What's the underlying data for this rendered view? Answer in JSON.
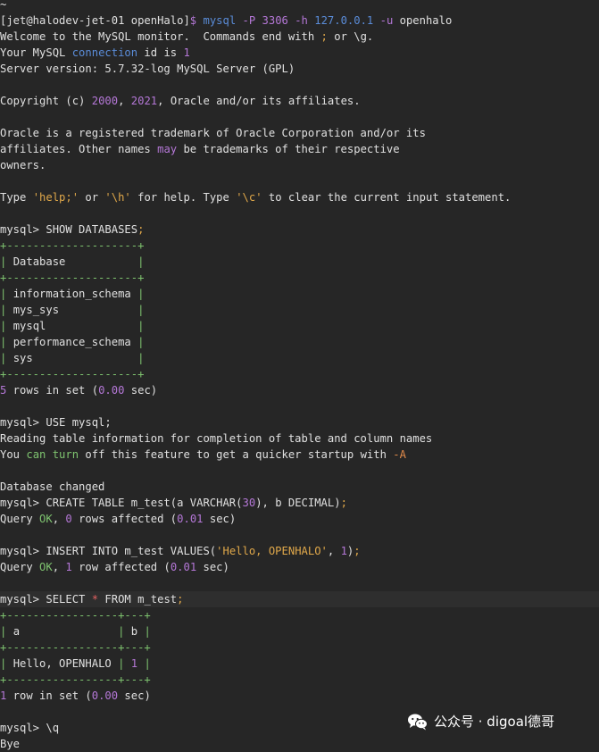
{
  "terminal": {
    "lines": [
      {
        "segs": [
          {
            "t": "~",
            "c": "w"
          }
        ]
      },
      {
        "segs": [
          {
            "t": "[jet@halodev-jet-01 openHalo]",
            "c": "w"
          },
          {
            "t": "$ ",
            "c": "p"
          },
          {
            "t": "mysql ",
            "c": "b"
          },
          {
            "t": "-P ",
            "c": "p"
          },
          {
            "t": "3306 ",
            "c": "p"
          },
          {
            "t": "-h ",
            "c": "p"
          },
          {
            "t": "127.0.0.1 ",
            "c": "b"
          },
          {
            "t": "-u ",
            "c": "p"
          },
          {
            "t": "openhalo",
            "c": "w"
          }
        ]
      },
      {
        "segs": [
          {
            "t": "Welcome to the MySQL monitor.  Commands end with ",
            "c": "w"
          },
          {
            "t": ";",
            "c": "y"
          },
          {
            "t": " or \\g.",
            "c": "w"
          }
        ]
      },
      {
        "segs": [
          {
            "t": "Your MySQL ",
            "c": "w"
          },
          {
            "t": "connection",
            "c": "b"
          },
          {
            "t": " id is ",
            "c": "w"
          },
          {
            "t": "1",
            "c": "p"
          }
        ]
      },
      {
        "segs": [
          {
            "t": "Server version: 5.7.32-log MySQL Server (GPL)",
            "c": "w"
          }
        ]
      },
      {
        "segs": []
      },
      {
        "segs": [
          {
            "t": "Copyright (c) ",
            "c": "w"
          },
          {
            "t": "2000",
            "c": "p"
          },
          {
            "t": ", ",
            "c": "w"
          },
          {
            "t": "2021",
            "c": "p"
          },
          {
            "t": ", Oracle and/or its affiliates.",
            "c": "w"
          }
        ]
      },
      {
        "segs": []
      },
      {
        "segs": [
          {
            "t": "Oracle is a registered trademark of Oracle Corporation and/or its",
            "c": "w"
          }
        ]
      },
      {
        "segs": [
          {
            "t": "affiliates. Other names ",
            "c": "w"
          },
          {
            "t": "may",
            "c": "p"
          },
          {
            "t": " be trademarks of their respective",
            "c": "w"
          }
        ]
      },
      {
        "segs": [
          {
            "t": "owners.",
            "c": "w"
          }
        ]
      },
      {
        "segs": []
      },
      {
        "segs": [
          {
            "t": "Type ",
            "c": "w"
          },
          {
            "t": "'help;'",
            "c": "y"
          },
          {
            "t": " or ",
            "c": "w"
          },
          {
            "t": "'\\h'",
            "c": "y"
          },
          {
            "t": " for help. Type ",
            "c": "w"
          },
          {
            "t": "'\\c'",
            "c": "y"
          },
          {
            "t": " to clear the current input statement.",
            "c": "w"
          }
        ]
      },
      {
        "segs": []
      },
      {
        "segs": [
          {
            "t": "mysql> SHOW DATABASES",
            "c": "w"
          },
          {
            "t": ";",
            "c": "y"
          }
        ]
      },
      {
        "segs": [
          {
            "t": "+--------------------+",
            "c": "g"
          }
        ]
      },
      {
        "segs": [
          {
            "t": "| ",
            "c": "g"
          },
          {
            "t": "Database           ",
            "c": "w"
          },
          {
            "t": "|",
            "c": "g"
          }
        ]
      },
      {
        "segs": [
          {
            "t": "+--------------------+",
            "c": "g"
          }
        ]
      },
      {
        "segs": [
          {
            "t": "| ",
            "c": "g"
          },
          {
            "t": "information_schema ",
            "c": "w"
          },
          {
            "t": "|",
            "c": "g"
          }
        ]
      },
      {
        "segs": [
          {
            "t": "| ",
            "c": "g"
          },
          {
            "t": "mys_sys            ",
            "c": "w"
          },
          {
            "t": "|",
            "c": "g"
          }
        ]
      },
      {
        "segs": [
          {
            "t": "| ",
            "c": "g"
          },
          {
            "t": "mysql              ",
            "c": "w"
          },
          {
            "t": "|",
            "c": "g"
          }
        ]
      },
      {
        "segs": [
          {
            "t": "| ",
            "c": "g"
          },
          {
            "t": "performance_schema ",
            "c": "w"
          },
          {
            "t": "|",
            "c": "g"
          }
        ]
      },
      {
        "segs": [
          {
            "t": "| ",
            "c": "g"
          },
          {
            "t": "sys                ",
            "c": "w"
          },
          {
            "t": "|",
            "c": "g"
          }
        ]
      },
      {
        "segs": [
          {
            "t": "+--------------------+",
            "c": "g"
          }
        ]
      },
      {
        "segs": [
          {
            "t": "5",
            "c": "p"
          },
          {
            "t": " rows in set (",
            "c": "w"
          },
          {
            "t": "0.00",
            "c": "p"
          },
          {
            "t": " sec)",
            "c": "w"
          }
        ]
      },
      {
        "segs": []
      },
      {
        "segs": [
          {
            "t": "mysql> USE mysql;",
            "c": "w"
          }
        ]
      },
      {
        "segs": [
          {
            "t": "Reading table information for completion of table and column names",
            "c": "w"
          }
        ]
      },
      {
        "segs": [
          {
            "t": "You ",
            "c": "w"
          },
          {
            "t": "can turn",
            "c": "g"
          },
          {
            "t": " off this feature to get a quicker startup with ",
            "c": "w"
          },
          {
            "t": "-A",
            "c": "o"
          }
        ]
      },
      {
        "segs": []
      },
      {
        "segs": [
          {
            "t": "Database changed",
            "c": "w"
          }
        ]
      },
      {
        "segs": [
          {
            "t": "mysql> CREATE TABLE m_test(a VARCHAR(",
            "c": "w"
          },
          {
            "t": "30",
            "c": "p"
          },
          {
            "t": "), b DECIMAL)",
            "c": "w"
          },
          {
            "t": ";",
            "c": "y"
          }
        ]
      },
      {
        "segs": [
          {
            "t": "Query ",
            "c": "w"
          },
          {
            "t": "OK",
            "c": "g"
          },
          {
            "t": ", ",
            "c": "w"
          },
          {
            "t": "0",
            "c": "p"
          },
          {
            "t": " rows affected (",
            "c": "w"
          },
          {
            "t": "0.01",
            "c": "p"
          },
          {
            "t": " sec)",
            "c": "w"
          }
        ]
      },
      {
        "segs": []
      },
      {
        "segs": [
          {
            "t": "mysql> INSERT INTO m_test VALUES(",
            "c": "w"
          },
          {
            "t": "'Hello, OPENHALO'",
            "c": "y"
          },
          {
            "t": ", ",
            "c": "w"
          },
          {
            "t": "1",
            "c": "p"
          },
          {
            "t": ")",
            "c": "w"
          },
          {
            "t": ";",
            "c": "y"
          }
        ]
      },
      {
        "segs": [
          {
            "t": "Query ",
            "c": "w"
          },
          {
            "t": "OK",
            "c": "g"
          },
          {
            "t": ", ",
            "c": "w"
          },
          {
            "t": "1",
            "c": "p"
          },
          {
            "t": " row affected (",
            "c": "w"
          },
          {
            "t": "0.01",
            "c": "p"
          },
          {
            "t": " sec)",
            "c": "w"
          }
        ]
      },
      {
        "segs": []
      },
      {
        "hl": true,
        "segs": [
          {
            "t": "mysql> SELECT ",
            "c": "w"
          },
          {
            "t": "*",
            "c": "r"
          },
          {
            "t": " FROM m_test",
            "c": "w"
          },
          {
            "t": ";",
            "c": "y"
          }
        ]
      },
      {
        "segs": [
          {
            "t": "+-----------------+---+",
            "c": "g"
          }
        ]
      },
      {
        "segs": [
          {
            "t": "| ",
            "c": "g"
          },
          {
            "t": "a               ",
            "c": "w"
          },
          {
            "t": "| ",
            "c": "g"
          },
          {
            "t": "b ",
            "c": "w"
          },
          {
            "t": "|",
            "c": "g"
          }
        ]
      },
      {
        "segs": [
          {
            "t": "+-----------------+---+",
            "c": "g"
          }
        ]
      },
      {
        "segs": [
          {
            "t": "| ",
            "c": "g"
          },
          {
            "t": "Hello, OPENHALO ",
            "c": "w"
          },
          {
            "t": "| ",
            "c": "g"
          },
          {
            "t": "1",
            "c": "p"
          },
          {
            "t": " |",
            "c": "g"
          }
        ]
      },
      {
        "segs": [
          {
            "t": "+-----------------+---+",
            "c": "g"
          }
        ]
      },
      {
        "segs": [
          {
            "t": "1",
            "c": "p"
          },
          {
            "t": " row in set (",
            "c": "w"
          },
          {
            "t": "0.00",
            "c": "p"
          },
          {
            "t": " sec)",
            "c": "w"
          }
        ]
      },
      {
        "segs": []
      },
      {
        "segs": [
          {
            "t": "mysql> \\q",
            "c": "w"
          }
        ]
      },
      {
        "segs": [
          {
            "t": "Bye",
            "c": "w"
          }
        ]
      }
    ]
  },
  "watermark": {
    "icon": "wechat-icon",
    "text": "公众号 · digoal德哥"
  }
}
